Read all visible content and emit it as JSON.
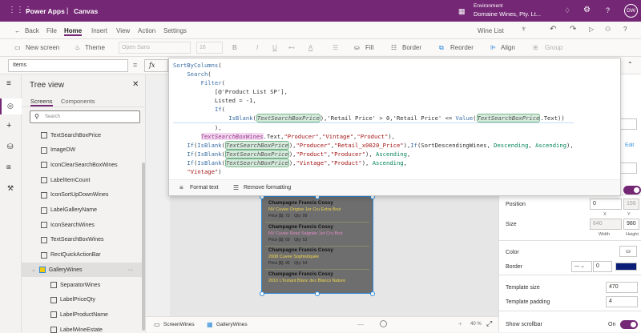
{
  "app": {
    "title": "Power Apps",
    "mode": "Canvas",
    "env_label": "Environment",
    "env_name": "Domaine Wines, Pty. Lt...",
    "avatar": "DW",
    "brand_color": "#742774"
  },
  "menu": {
    "back": "Back",
    "items": [
      "File",
      "Home",
      "Insert",
      "View",
      "Action",
      "Settings"
    ],
    "app_name": "Wine List"
  },
  "toolbar": {
    "new_screen": "New screen",
    "theme": "Theme",
    "font": "Open Sans",
    "font_size": "16",
    "fill": "Fill",
    "border": "Border",
    "reorder": "Reorder",
    "align": "Align",
    "group": "Group"
  },
  "formula": {
    "property": "Items",
    "fx": "fx",
    "eq": "="
  },
  "code": {
    "lines": [
      "SortByColumns(",
      "    Search(",
      "        Filter(",
      "            [@'Product List SP'],",
      "            Listed = -1,",
      "            If(",
      "                IsBlank(TextSearchBoxPrice),'Retail Price' > 0,'Retail Price' <= Value(TextSearchBoxPrice.Text))",
      "            ),",
      "        TextSearchBoxWines.Text,\"Producer\",\"Vintage\",\"Product\"),",
      "    If(IsBlank(TextSearchBoxPrice),\"Producer\",\"Retail_x0020_Price\"),If(SortDescendingWines, Descending, Ascending),",
      "    If(IsBlank(TextSearchBoxPrice),\"Product\",\"Producer\"), Ascending,",
      "    If(IsBlank(TextSearchBoxPrice),\"Vintage\",\"Product\"), Ascending,",
      "    \"Vintage\")"
    ],
    "format_text": "Format text",
    "remove_formatting": "Remove formatting"
  },
  "tree": {
    "title": "Tree view",
    "tabs": [
      "Screens",
      "Components"
    ],
    "search_placeholder": "Search",
    "items": [
      {
        "label": "TextSearchBoxPrice"
      },
      {
        "label": "ImageDW"
      },
      {
        "label": "IconClearSearchBoxWines"
      },
      {
        "label": "LabelItemCount"
      },
      {
        "label": "IconSortUpDownWines"
      },
      {
        "label": "LabelGalleryName"
      },
      {
        "label": "IconSearchWines"
      },
      {
        "label": "TextSearchBoxWines"
      },
      {
        "label": "RectQuickActionBar"
      },
      {
        "label": "GalleryWines",
        "selected": true
      },
      {
        "label": "SeparatorWines"
      },
      {
        "label": "LabelPriceQty"
      },
      {
        "label": "LabelProductName"
      },
      {
        "label": "LabelWineEstate"
      }
    ]
  },
  "gallery": [
    {
      "producer": "Champagne Francis Cossy",
      "product": "NV Cuvée Origine 1er Cru Extra Brut",
      "price": "Price [$]: 73    Qty: 99",
      "color": "#f2d64b"
    },
    {
      "producer": "Champagne Francis Cossy",
      "product": "NV Cuvée Rosé Saignée 1er Cru Brut",
      "price": "Price [$]: 69    Qty: 52",
      "color": "#e58bc9"
    },
    {
      "producer": "Champagne Francis Cossy",
      "product": "2008 Cuvée Sophistiquée",
      "price": "Price [$]: 95    Qty: 54",
      "color": "#f2d64b"
    },
    {
      "producer": "Champagne Francis Cossy",
      "product": "2010 L'Instant Blanc des Blancs Nature",
      "price": "",
      "color": "#f2d64b"
    }
  ],
  "props": {
    "edit": "Edit",
    "position": "Position",
    "x": "0",
    "y": "156",
    "x_label": "X",
    "y_label": "Y",
    "size": "Size",
    "width": "640",
    "height": "980",
    "w_label": "Width",
    "h_label": "Height",
    "color": "Color",
    "border": "Border",
    "border_width": "0",
    "border_color": "#0b1f78",
    "template_size_label": "Template size",
    "template_size": "470",
    "template_padding_label": "Template padding",
    "template_padding": "4",
    "show_scrollbar": "Show scrollbar",
    "scrollbar_state": "On"
  },
  "bottom": {
    "screen": "ScreenWines",
    "control": "GalleryWines",
    "zoom": "40 %"
  }
}
